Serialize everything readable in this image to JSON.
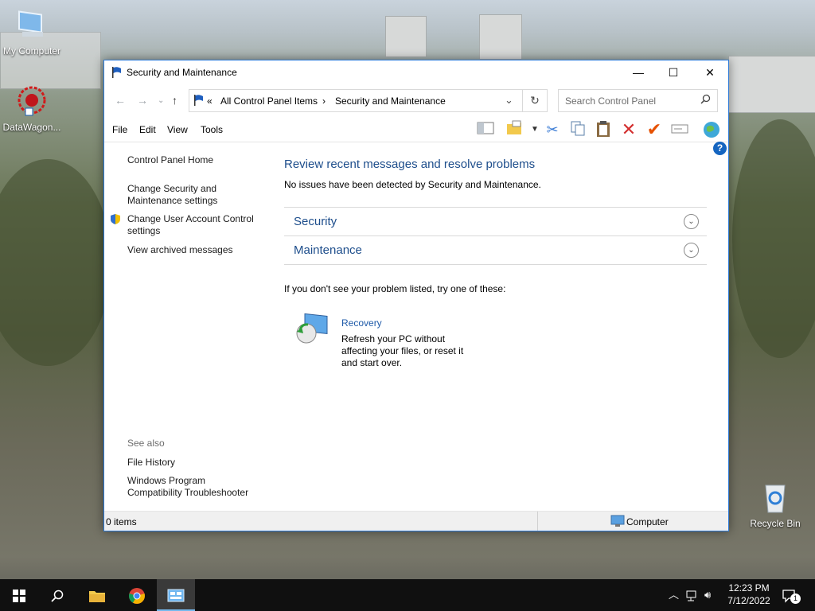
{
  "desktop": {
    "icons": [
      {
        "label": "My Computer"
      },
      {
        "label": "DataWagon..."
      },
      {
        "label": "Recycle Bin"
      }
    ]
  },
  "window": {
    "title": "Security and Maintenance",
    "controls": {
      "minimize": "—",
      "maximize": "☐",
      "close": "✕"
    },
    "address": {
      "prefix": "«",
      "crumbs": [
        "All Control Panel Items",
        "Security and Maintenance"
      ],
      "separator": "›"
    },
    "search_placeholder": "Search Control Panel",
    "menu": [
      "File",
      "Edit",
      "View",
      "Tools"
    ],
    "left_links": [
      "Control Panel Home",
      "Change Security and Maintenance settings",
      "Change User Account Control settings",
      "View archived messages"
    ],
    "see_also": {
      "heading": "See also",
      "links": [
        "File History",
        "Windows Program Compatibility Troubleshooter"
      ]
    },
    "main": {
      "heading": "Review recent messages and resolve problems",
      "subheading": "No issues have been detected by Security and Maintenance.",
      "sections": [
        "Security",
        "Maintenance"
      ],
      "try_line": "If you don't see your problem listed, try one of these:",
      "recovery": {
        "title": "Recovery",
        "description": "Refresh your PC without affecting your files, or reset it and start over."
      }
    },
    "status": {
      "items": "0 items",
      "location": "Computer"
    }
  },
  "taskbar": {
    "time": "12:23 PM",
    "date": "7/12/2022",
    "notification_count": "1"
  },
  "colors": {
    "link_blue": "#1e4e8c",
    "accent": "#2b79d8"
  }
}
